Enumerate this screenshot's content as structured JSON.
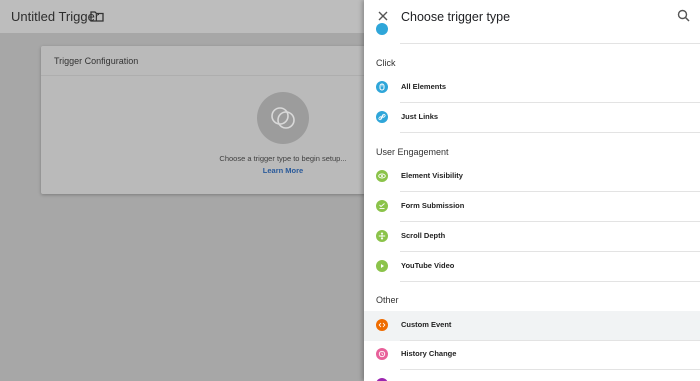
{
  "editor": {
    "title": "Untitled Trigger",
    "card_title": "Trigger Configuration",
    "hint": "Choose a trigger type to begin setup...",
    "learn_more": "Learn More"
  },
  "panel": {
    "title": "Choose trigger type",
    "sections": {
      "click": "Click",
      "engagement": "User Engagement",
      "other": "Other"
    },
    "items": [
      {
        "label": "All Elements",
        "icon": "cursor-icon",
        "color": "#2fa6d9"
      },
      {
        "label": "Just Links",
        "icon": "link-icon",
        "color": "#2fa6d9"
      },
      {
        "label": "Element Visibility",
        "icon": "eye-icon",
        "color": "#8bc34a"
      },
      {
        "label": "Form Submission",
        "icon": "form-icon",
        "color": "#8bc34a"
      },
      {
        "label": "Scroll Depth",
        "icon": "scroll-icon",
        "color": "#8bc34a"
      },
      {
        "label": "YouTube Video",
        "icon": "play-icon",
        "color": "#8bc34a"
      },
      {
        "label": "Custom Event",
        "icon": "code-icon",
        "color": "#ef6c00"
      },
      {
        "label": "History Change",
        "icon": "history-icon",
        "color": "#e8609a"
      }
    ]
  }
}
